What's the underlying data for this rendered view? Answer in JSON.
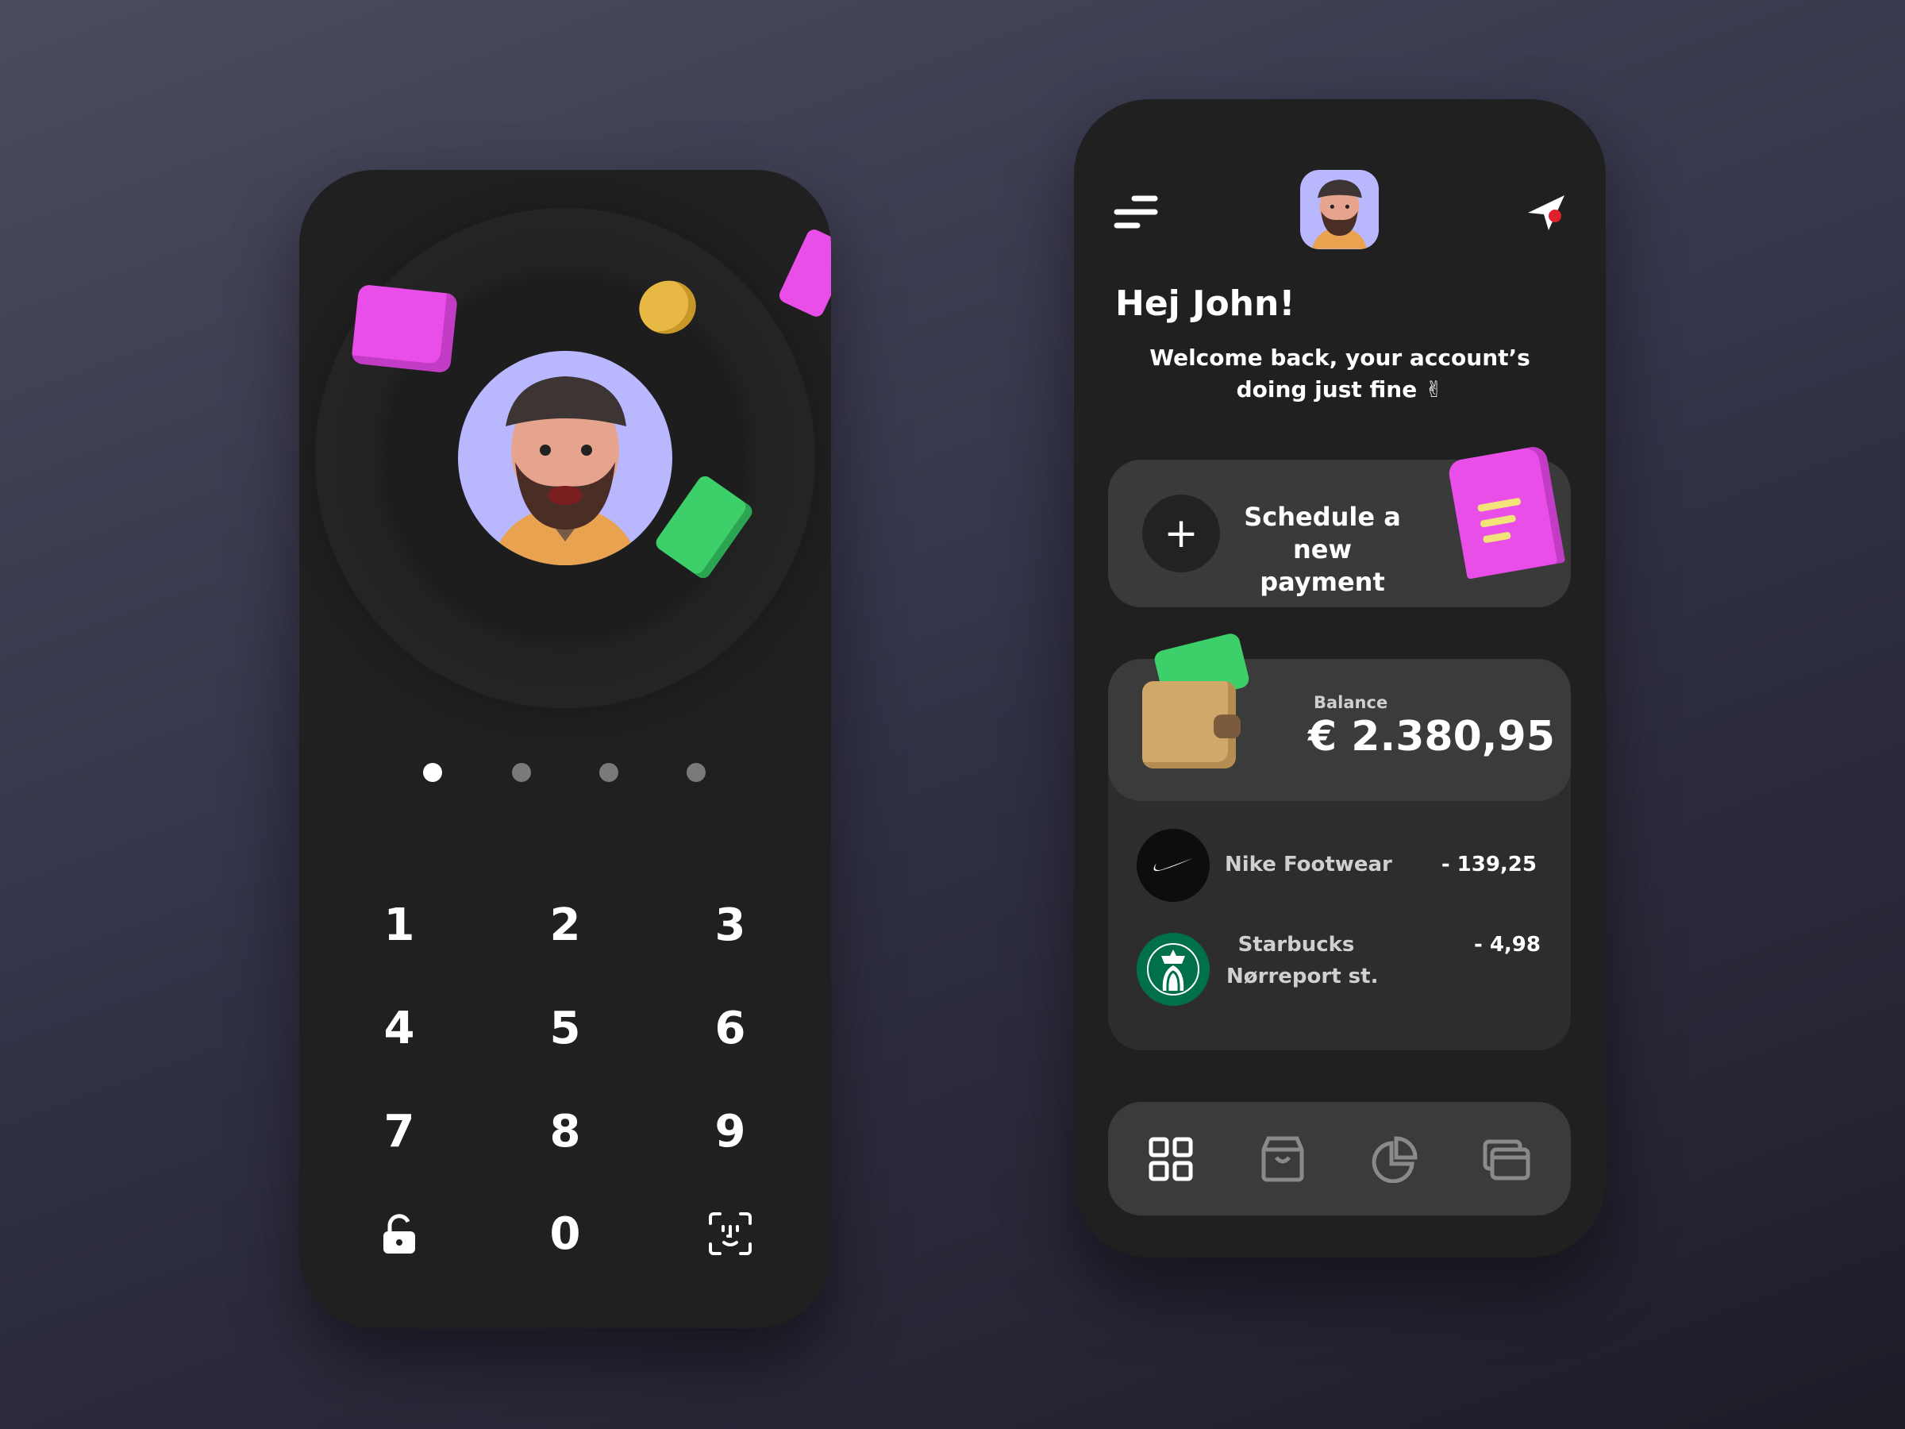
{
  "login_screen": {
    "pin_dots": {
      "total": 4,
      "filled": 1
    },
    "keypad": [
      "1",
      "2",
      "3",
      "4",
      "5",
      "6",
      "7",
      "8",
      "9",
      "unlock-icon",
      "0",
      "face-id-icon"
    ]
  },
  "home_screen": {
    "header": {
      "menu_icon": "menu-icon",
      "send_icon": "paper-plane-icon",
      "notification_color": "#e0202a"
    },
    "greeting": "Hej John!",
    "subtitle_line1": "Welcome back, your account’s",
    "subtitle_line2": "doing just fine ✌",
    "schedule": {
      "line1": "Schedule a",
      "line2": "new payment"
    },
    "balance": {
      "label": "Balance",
      "value": "€ 2.380,95"
    },
    "transactions": [
      {
        "merchant": "Nike Footwear",
        "amount": "- 139,25"
      },
      {
        "merchant": "Starbucks",
        "location": "Nørreport st.",
        "amount": "- 4,98"
      }
    ],
    "nav": [
      "grid-icon",
      "shopping-bag-icon",
      "pie-chart-icon",
      "cards-icon"
    ],
    "colors": {
      "accent_pink": "#e44fe6",
      "green": "#3dd06a",
      "starbucks": "#00704a"
    }
  }
}
